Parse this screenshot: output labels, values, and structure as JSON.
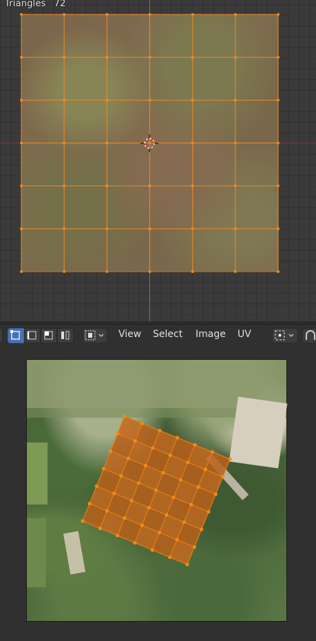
{
  "viewport": {
    "stats_label": "Triangles",
    "stats_value": "72"
  },
  "uv_header": {
    "menu": [
      "View",
      "Select",
      "Image",
      "UV"
    ]
  },
  "icons": {
    "select_modes": [
      "vertex-select-icon",
      "edge-select-icon",
      "face-select-icon",
      "island-select-icon"
    ],
    "sticky": "sticky-selection-icon",
    "pivot": "pivot-point-icon",
    "snap": "snap-icon"
  },
  "colors": {
    "selection_orange": "#f28a1c",
    "accent_blue": "#4772b3",
    "axis_x": "#8a3a45",
    "axis_y": "#5f8a2e"
  }
}
